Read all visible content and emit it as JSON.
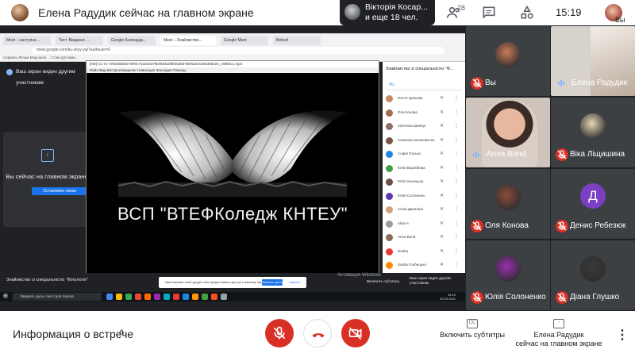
{
  "header": {
    "title": "Елена Радудик сейчас на главном экране",
    "notification_line1": "Вікторія Косар...",
    "notification_line2": "и еще 18 чел.",
    "people_count": "28",
    "time": "15:19",
    "self_label": "Вы"
  },
  "shared_screen": {
    "browser_tabs": [
      "Meet – наступне...",
      "Тест. Видання ...",
      "Google Календар...",
      "Meet – Знайомство...",
      "Google Meet",
      "Betexit"
    ],
    "url": "meet.google.com/tiu-zkyy-yq/?authuser=0",
    "bookmarks": "Сервисы   Фільм Марсіанін ...   Стіни для кімн...",
    "share_banner": "Ваш экран виден другим участникам",
    "presenting_text": "Вы сейчас на главном экране",
    "stop_button": "Остановить показ",
    "player_title": "[HD] Go Yo 72f3eB5b65749f4c722a02a7f8ef554a0f5f30d587bfe5d2ec00530b22e_c80b5c1.mp4",
    "player_menu": "Файл  Вид  Воспроизведение  Навигация  Закладки  Помощь",
    "video_caption": "ВСП \"ВТЕФКоледж КНТЕУ\"",
    "player_status": "Воспроизведение [H.264]",
    "player_progress": 0.16,
    "panel_title": "Знайомство зі спеціальністю \"Ф...",
    "panel_tab_all": "Усі",
    "participants": [
      {
        "name": "Настя Цапкова",
        "color": "#c58b63"
      },
      {
        "name": "Оля Конова",
        "color": "#a06b4e"
      },
      {
        "name": "Світлана Шевчук",
        "color": "#8d6e63"
      },
      {
        "name": "Снежана Качановська",
        "color": "#795548"
      },
      {
        "name": "Софія Пасько",
        "color": "#1e88e5"
      },
      {
        "name": "Юлія Воробйова",
        "color": "#43a047"
      },
      {
        "name": "Юлія Ільницька",
        "color": "#6d4c41"
      },
      {
        "name": "Юлія Солоненко",
        "color": "#5e35b1"
      },
      {
        "name": "Аліна Даниліна",
        "color": "#d4a07b"
      },
      {
        "name": "Alina A",
        "color": "#9e9e9e"
      },
      {
        "name": "Anna Bond",
        "color": "#8e6b5a"
      },
      {
        "name": "Dasha",
        "color": "#e53935"
      },
      {
        "name": "Sasha Голбецька",
        "color": "#fb8c00"
      }
    ],
    "bottom_left": "Знайомство зі спеціальністю \"Філологія\"",
    "notice": "Приложение meet.google.com предоставило доступ к вашему экрану.",
    "notice_button": "Закрыть доступ",
    "notice_hide": "Скрыть",
    "activate": "Активация Windows",
    "enable_subtitles": "Включить субтитры",
    "screen_visible": "Ваш экран виден другим участникам",
    "taskbar_search": "Введите здесь текст для поиска",
    "taskbar_time": "15:19",
    "taskbar_date": "25.03.2021"
  },
  "tiles": [
    {
      "name": "Вы",
      "muted": true,
      "color": "#c97b5a"
    },
    {
      "name": "Елена Радудик",
      "muted": false,
      "color": "#d6c2b0"
    },
    {
      "name": "Anna Bond",
      "muted": false,
      "color": "#b98a72"
    },
    {
      "name": "Віка Ліщишина",
      "muted": true,
      "color": "#e7d7b5"
    },
    {
      "name": "Оля Конова",
      "muted": true,
      "color": "#8a4c3b"
    },
    {
      "name": "Денис Ребезюк",
      "muted": true,
      "letter": "Д",
      "color": "#7b3fc4"
    },
    {
      "name": "Юлія Солоненко",
      "muted": true,
      "color": "#9b2fae"
    },
    {
      "name": "Діана Глушко",
      "muted": true,
      "color": "#3a3a3a"
    }
  ],
  "bottom": {
    "meeting_info": "Информация о встрече",
    "subtitles": "Включить субтитры",
    "presenter_line1": "Елена Радудик",
    "presenter_line2": "сейчас на главном экране",
    "accent_red": "#d93025"
  }
}
